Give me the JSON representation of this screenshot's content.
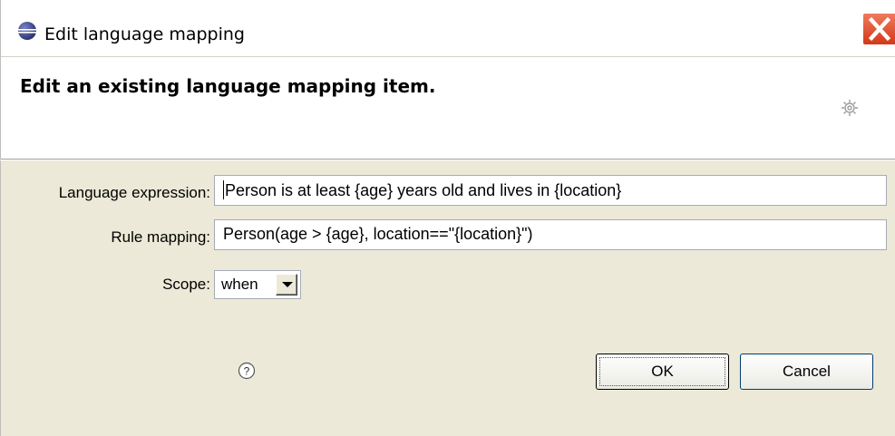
{
  "window": {
    "title": "Edit language mapping"
  },
  "banner": {
    "title": "Edit an existing language mapping item."
  },
  "form": {
    "expression_label": "Language expression:",
    "expression_value": "Person is at least {age} years old and lives in {location}",
    "rule_label": "Rule mapping:",
    "rule_value": "Person(age > {age}, location==\"{location}\")",
    "scope_label": "Scope:",
    "scope_value": "when"
  },
  "buttons": {
    "ok": "OK",
    "cancel": "Cancel"
  },
  "icons": {
    "app": "eclipse-icon",
    "close": "close-icon",
    "banner": "gear-icon",
    "help": "help-icon",
    "dropdown": "chevron-down-icon"
  },
  "colors": {
    "dialog_bg": "#ece9d8",
    "close_red": "#d4381a",
    "button_border": "#003c74"
  }
}
